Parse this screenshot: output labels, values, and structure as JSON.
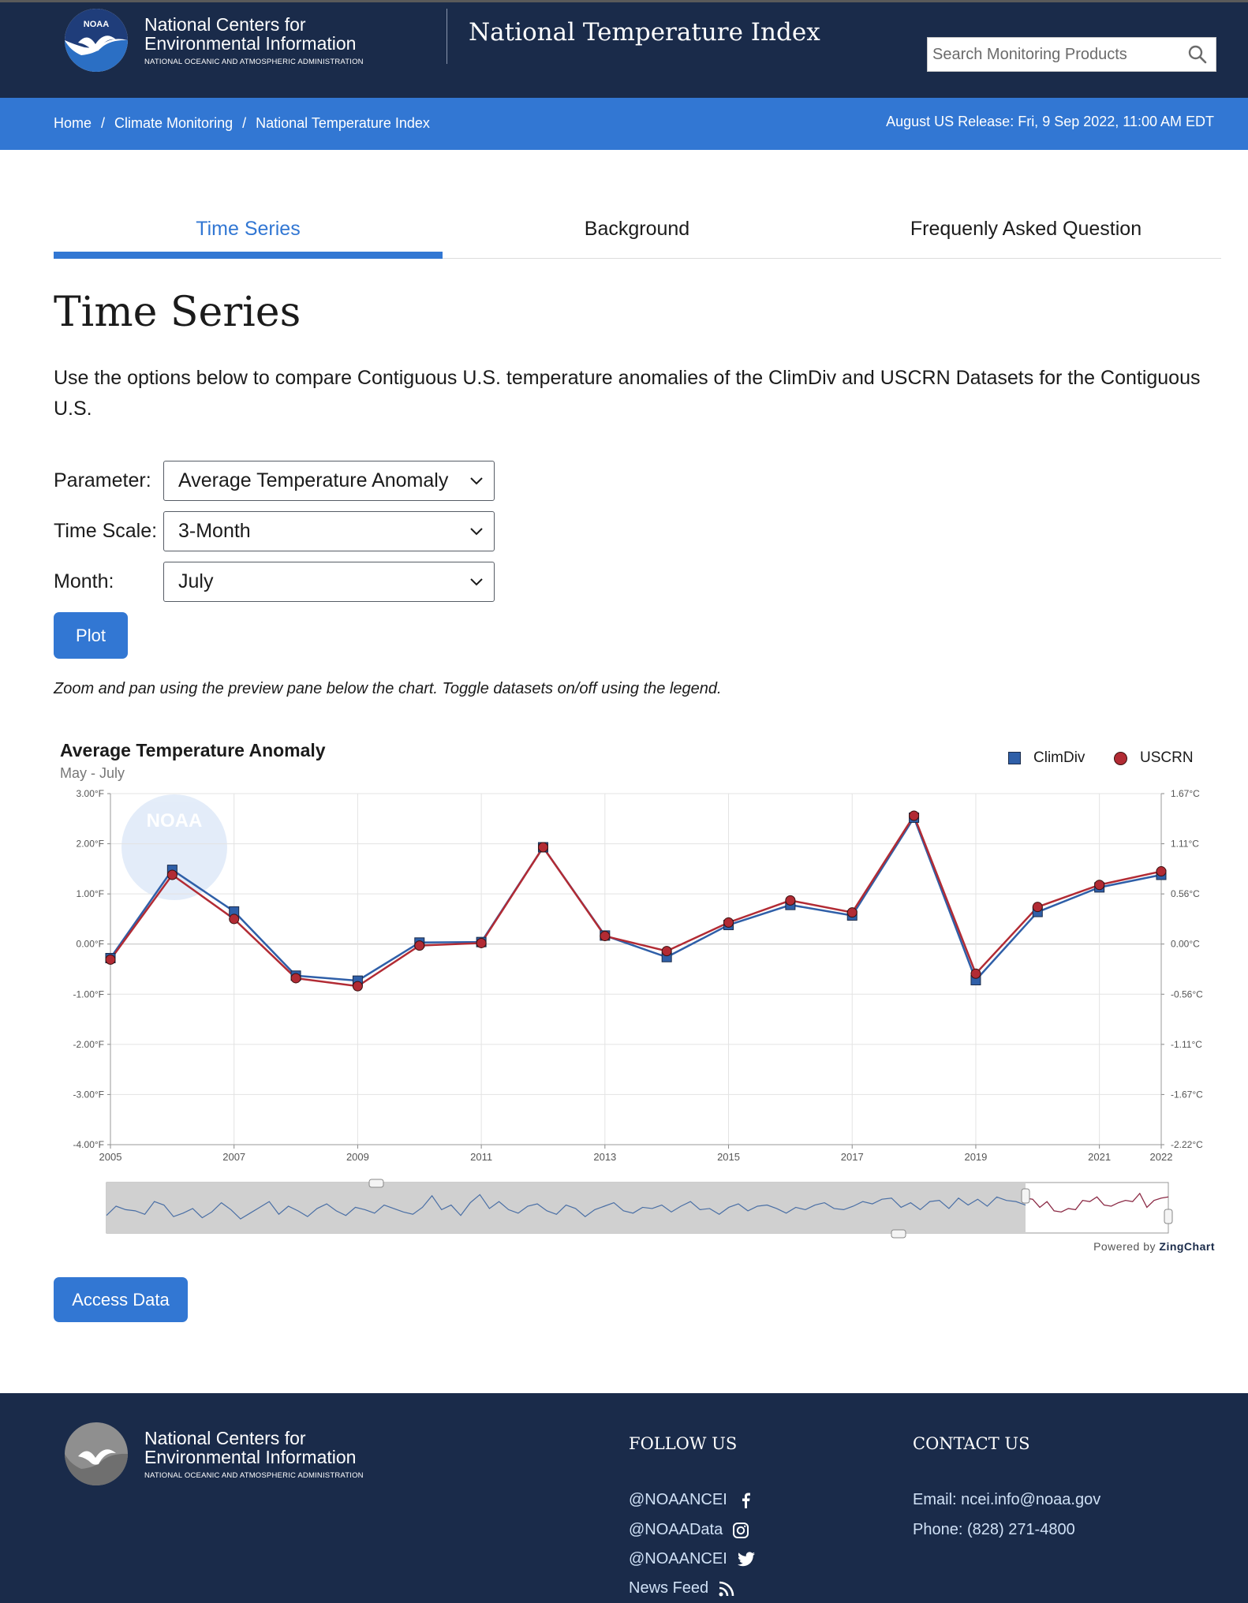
{
  "header": {
    "org_line1": "National Centers for",
    "org_line2": "Environmental Information",
    "org_sub": "NATIONAL OCEANIC AND ATMOSPHERIC ADMINISTRATION",
    "logo_text": "NOAA",
    "title": "National Temperature Index",
    "search_placeholder": "Search Monitoring Products"
  },
  "breadcrumb": {
    "items": [
      "Home",
      "Climate Monitoring",
      "National Temperature Index"
    ],
    "release": "August US Release: Fri, 9 Sep 2022, 11:00 AM EDT"
  },
  "tabs": [
    "Time Series",
    "Background",
    "Frequenly Asked Question"
  ],
  "page": {
    "title": "Time Series",
    "intro": "Use the options below to compare Contiguous U.S. temperature anomalies of the ClimDiv and USCRN Datasets for the Contiguous U.S.",
    "hint": "Zoom and pan using the preview pane below the chart. Toggle datasets on/off using the legend."
  },
  "form": {
    "parameter_label": "Parameter:",
    "parameter_value": "Average Temperature Anomaly",
    "timescale_label": "Time Scale:",
    "timescale_value": "3-Month",
    "month_label": "Month:",
    "month_value": "July",
    "plot_button": "Plot",
    "access_button": "Access Data"
  },
  "chart_data": {
    "type": "line",
    "title": "Average Temperature Anomaly",
    "subtitle": "May - July",
    "x": [
      2005,
      2006,
      2007,
      2008,
      2009,
      2010,
      2011,
      2012,
      2013,
      2014,
      2015,
      2016,
      2017,
      2018,
      2019,
      2020,
      2021,
      2022
    ],
    "x_ticks": [
      "2005",
      "2007",
      "2009",
      "2011",
      "2013",
      "2015",
      "2017",
      "2019",
      "2021",
      "2022"
    ],
    "y_ticks_left": [
      "3.00°F",
      "2.00°F",
      "1.00°F",
      "0.00°F",
      "-1.00°F",
      "-2.00°F",
      "-3.00°F",
      "-4.00°F"
    ],
    "y_ticks_right": [
      "1.67°C",
      "1.11°C",
      "0.56°C",
      "0.00°C",
      "-0.56°C",
      "-1.11°C",
      "-1.67°C",
      "-2.22°C"
    ],
    "ylim": [
      -4,
      3
    ],
    "series": [
      {
        "name": "ClimDiv",
        "color": "#2f5fa8",
        "marker": "square",
        "values": [
          -0.28,
          1.48,
          0.65,
          -0.63,
          -0.73,
          0.03,
          0.04,
          1.93,
          0.17,
          -0.26,
          0.38,
          0.78,
          0.57,
          2.52,
          -0.72,
          0.64,
          1.13,
          1.38
        ]
      },
      {
        "name": "USCRN",
        "color": "#b22b34",
        "marker": "circle",
        "values": [
          -0.31,
          1.38,
          0.5,
          -0.68,
          -0.84,
          -0.03,
          0.02,
          1.93,
          0.16,
          -0.14,
          0.43,
          0.87,
          0.63,
          2.56,
          -0.59,
          0.74,
          1.18,
          1.45
        ]
      }
    ],
    "legend_position": "top-right",
    "grid": true,
    "y_axis_right_unit": "°C"
  },
  "preview": {
    "series": [
      -0.3,
      0.5,
      0.2,
      0.1,
      -0.2,
      0.9,
      0.6,
      -0.4,
      -0.1,
      0.3,
      -0.5,
      0.0,
      0.8,
      0.2,
      -0.6,
      -0.1,
      0.4,
      0.9,
      -0.2,
      0.5,
      0.1,
      -0.4,
      0.3,
      0.7,
      0.1,
      -0.3,
      0.4,
      0.2,
      -0.1,
      0.6,
      0.3,
      0.0,
      -0.2,
      0.4,
      1.4,
      0.2,
      0.6,
      -0.3,
      0.8,
      1.5,
      0.3,
      0.9,
      0.2,
      -0.1,
      0.5,
      0.7,
      0.1,
      -0.2,
      0.6,
      0.3,
      -0.4,
      0.2,
      0.5,
      0.8,
      0.1,
      -0.1,
      0.4,
      0.3,
      0.6,
      0.0,
      0.5,
      0.9,
      0.2,
      0.3,
      -0.2,
      0.4,
      0.7,
      0.1,
      0.5,
      0.6,
      0.3,
      -0.1,
      0.4,
      0.2,
      0.6,
      0.8,
      0.3,
      0.2,
      0.5,
      0.9,
      0.7,
      1.1,
      1.2,
      0.4,
      0.8,
      0.2,
      0.9,
      1.0,
      0.3,
      1.2,
      0.6,
      1.1,
      0.5,
      1.3,
      1.0,
      0.9,
      0.6
    ],
    "recent": [
      1.2,
      1.1,
      0.4,
      0.9,
      0.1,
      0.0,
      0.3,
      0.2,
      1.0,
      0.9,
      1.3,
      0.6,
      0.5,
      0.8,
      1.0,
      0.9,
      1.6,
      0.4,
      1.0,
      1.2,
      1.3
    ]
  },
  "powered_by_prefix": "Powered by",
  "powered_by_brand": "ZingChart",
  "footer": {
    "org_line1": "National Centers for",
    "org_line2": "Environmental Information",
    "org_sub": "NATIONAL OCEANIC AND ATMOSPHERIC ADMINISTRATION",
    "follow_heading": "FOLLOW US",
    "social": [
      {
        "label": "@NOAANCEI",
        "icon": "facebook-icon"
      },
      {
        "label": "@NOAAData",
        "icon": "instagram-icon"
      },
      {
        "label": "@NOAANCEI",
        "icon": "twitter-icon"
      },
      {
        "label": "News Feed",
        "icon": "rss-icon"
      }
    ],
    "contact_heading": "CONTACT US",
    "email": "Email: ncei.info@noaa.gov",
    "phone": "Phone: (828) 271-4800"
  }
}
